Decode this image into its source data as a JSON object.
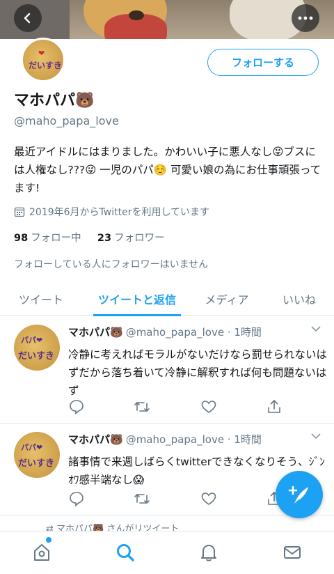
{
  "profile": {
    "name": "マホパパ🐻",
    "handle": "@maho_papa_love",
    "follow_label": "フォローする",
    "bio": "最近アイドルにはまりました。かわいい子に悪人なし😝ブスには人権なし???😜 一児のパパ☺️ 可愛い娘の為にお仕事頑張ってます!",
    "joined": "2019年6月からTwitterを利用しています",
    "following_count": "98",
    "following_label": "フォロー中",
    "followers_count": "23",
    "followers_label": "フォロワー",
    "mutual_note": "フォローしている人にフォロワーはいません"
  },
  "tabs": [
    {
      "label": "ツイート"
    },
    {
      "label": "ツイートと返信"
    },
    {
      "label": "メディア"
    },
    {
      "label": "いいね"
    }
  ],
  "tweets": [
    {
      "name": "マホパパ🐻",
      "meta": "@maho_papa_love · 1時間",
      "text": "冷静に考えればモラルがないだけなら罰せられないはずだから落ち着いて冷静に解釈すれば何も問題ないはず"
    },
    {
      "name": "マホパパ🐻",
      "meta": "@maho_papa_love · 1時間",
      "text": "諸事情で来週しばらくtwitterできなくなりそう、ｼﾞﾝｵﾜ感半端なし😱"
    }
  ],
  "retweet_notice": "マホパパ🐻 さんがリツイート",
  "colors": {
    "accent": "#1da1f2",
    "secondary_text": "#657786",
    "primary_text": "#14171a"
  },
  "icons": {
    "back": "back-arrow-icon",
    "more": "more-dots-icon",
    "calendar": "calendar-icon",
    "reply": "reply-icon",
    "retweet": "retweet-icon",
    "like": "heart-icon",
    "share": "share-icon",
    "compose": "compose-tweet-icon",
    "home": "home-icon",
    "search": "search-icon",
    "notifications": "bell-icon",
    "messages": "mail-icon"
  }
}
